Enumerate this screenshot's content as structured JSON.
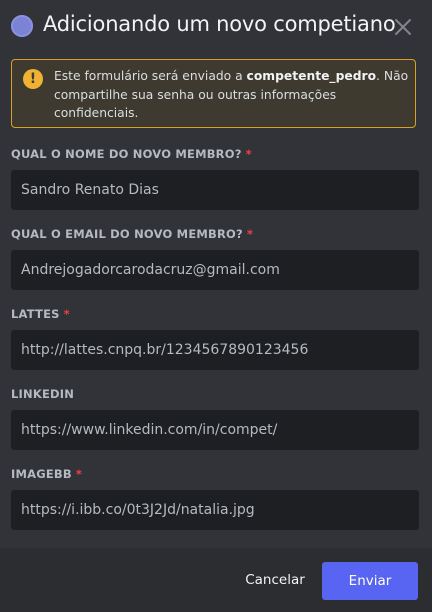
{
  "header": {
    "title": "Adicionando um novo competiano",
    "icon": "bot-avatar-icon",
    "close_icon": "close-icon"
  },
  "notice": {
    "icon": "warning-icon",
    "text_before": "Este formulário será enviado a ",
    "username": "competente_pedro",
    "text_after": ". Não compartilhe sua senha ou outras informações confidenciais."
  },
  "fields": [
    {
      "label": "QUAL O NOME DO NOVO MEMBRO?",
      "required": "*",
      "value": "Sandro Renato Dias"
    },
    {
      "label": "QUAL O EMAIL DO NOVO MEMBRO?",
      "required": "*",
      "value": "Andrejogadorcarodacruz@gmail.com"
    },
    {
      "label": "LATTES",
      "required": "*",
      "value": "http://lattes.cnpq.br/1234567890123456"
    },
    {
      "label": "LINKEDIN",
      "required": "",
      "value": "https://www.linkedin.com/in/compet/"
    },
    {
      "label": "IMAGEBB",
      "required": "*",
      "value": "https://i.ibb.co/0t3J2Jd/natalia.jpg"
    }
  ],
  "footer": {
    "cancel_label": "Cancelar",
    "submit_label": "Enviar"
  },
  "colors": {
    "background": "#313338",
    "footer": "#2b2d31",
    "input": "#1e1f22",
    "accent": "#5865f2",
    "warning": "#f0b232",
    "required": "#f23f43"
  }
}
